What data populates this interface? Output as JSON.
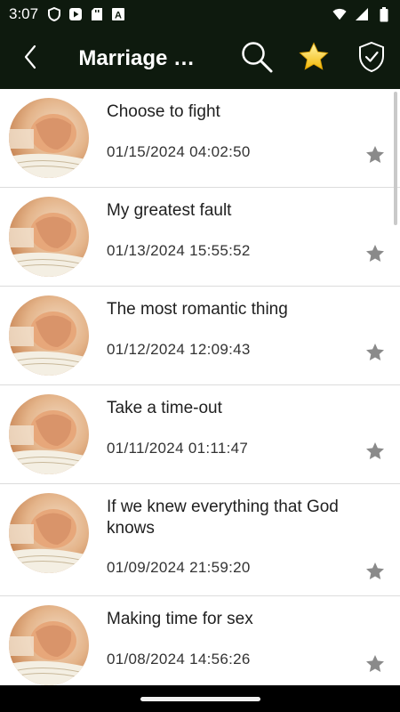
{
  "status_bar": {
    "time": "3:07",
    "left_icons": [
      "shield-icon",
      "play-store-icon",
      "sd-card-icon",
      "text-a-icon"
    ],
    "right_icons": [
      "wifi-icon",
      "signal-icon",
      "battery-icon"
    ]
  },
  "app_bar": {
    "title": "Marriage D…",
    "background": "#0e1a0e",
    "actions": [
      "search-icon",
      "star-icon",
      "verified-shield-icon"
    ],
    "star_color": "#f5c518"
  },
  "list": {
    "star_color": "#8a8a8a",
    "items": [
      {
        "title": "Choose to fight",
        "date": "01/15/2024 04:02:50"
      },
      {
        "title": "My greatest fault",
        "date": "01/13/2024 15:55:52"
      },
      {
        "title": "The most romantic thing",
        "date": "01/12/2024 12:09:43"
      },
      {
        "title": "Take a time-out",
        "date": "01/11/2024 01:11:47"
      },
      {
        "title": "If we knew everything that God knows",
        "date": "01/09/2024 21:59:20"
      },
      {
        "title": "Making time for sex",
        "date": "01/08/2024 14:56:26"
      }
    ]
  }
}
